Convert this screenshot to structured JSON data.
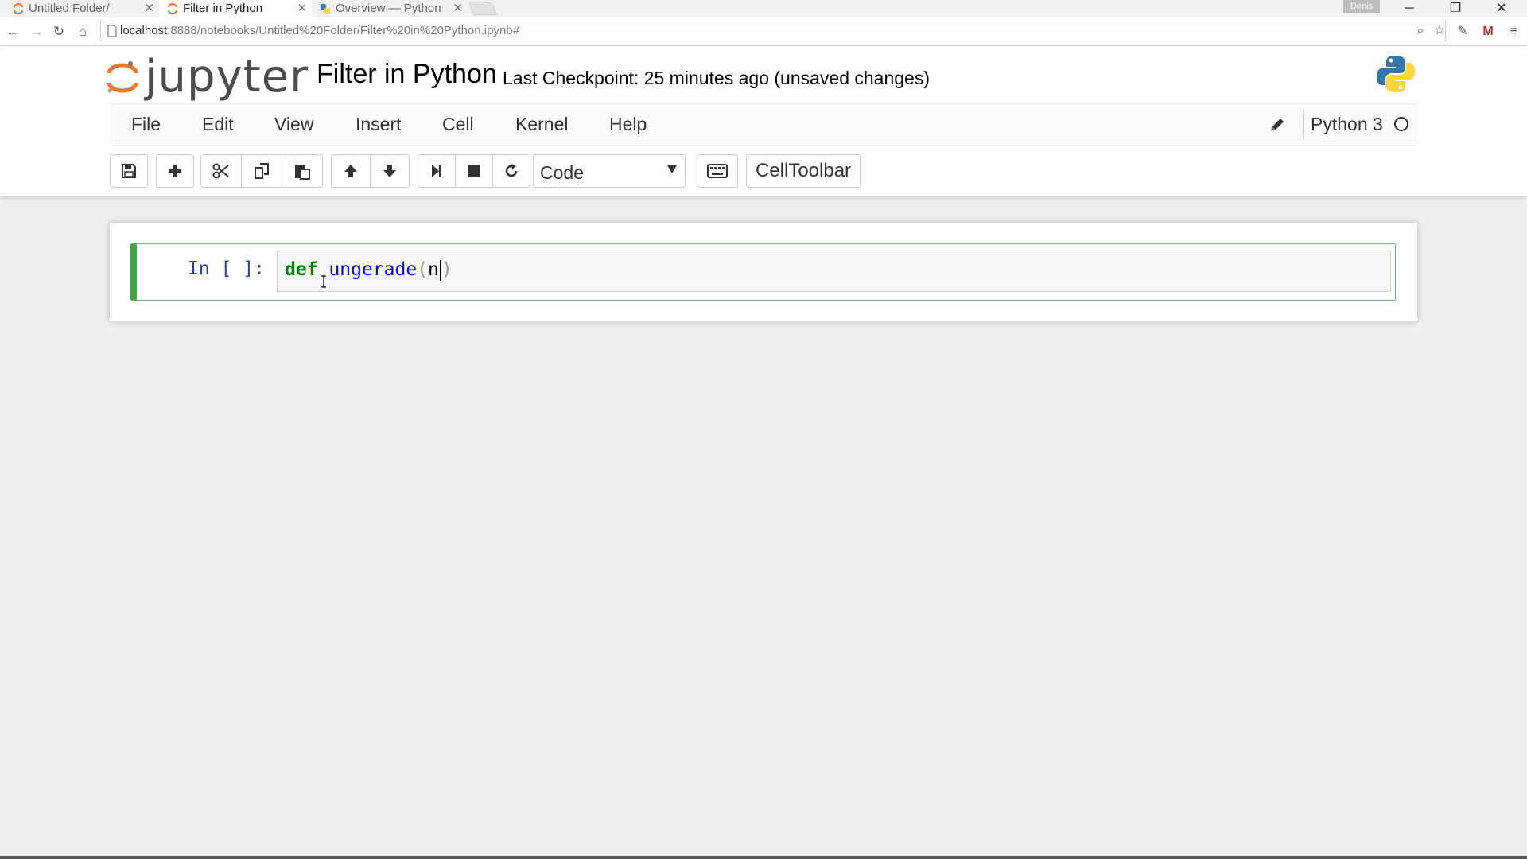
{
  "browser": {
    "tabs": [
      {
        "title": "Untitled Folder/",
        "active": false
      },
      {
        "title": "Filter in Python",
        "active": true
      },
      {
        "title": "Overview — Python",
        "active": false
      }
    ],
    "user_badge": "Denis",
    "url_host": "localhost",
    "url_rest": ":8888/notebooks/Untitled%20Folder/Filter%20in%20Python.ipynb#"
  },
  "header": {
    "logo_text": "jupyter",
    "notebook_title": "Filter in Python",
    "checkpoint": "Last Checkpoint: 25 minutes ago (unsaved changes)"
  },
  "menu": {
    "items": [
      "File",
      "Edit",
      "View",
      "Insert",
      "Cell",
      "Kernel",
      "Help"
    ],
    "kernel_name": "Python 3"
  },
  "toolbar": {
    "cell_type": "Code",
    "celltoolbar_label": "CellToolbar"
  },
  "cell": {
    "prompt": "In [ ]:",
    "code_keyword": "def",
    "code_space": " ",
    "code_function": "ungerade",
    "code_open": "(",
    "code_arg": "n",
    "code_close": ")"
  },
  "colors": {
    "accent_green": "#42a542",
    "prompt_blue": "#303f9f",
    "keyword_green": "#008000",
    "function_blue": "#0000ff"
  }
}
